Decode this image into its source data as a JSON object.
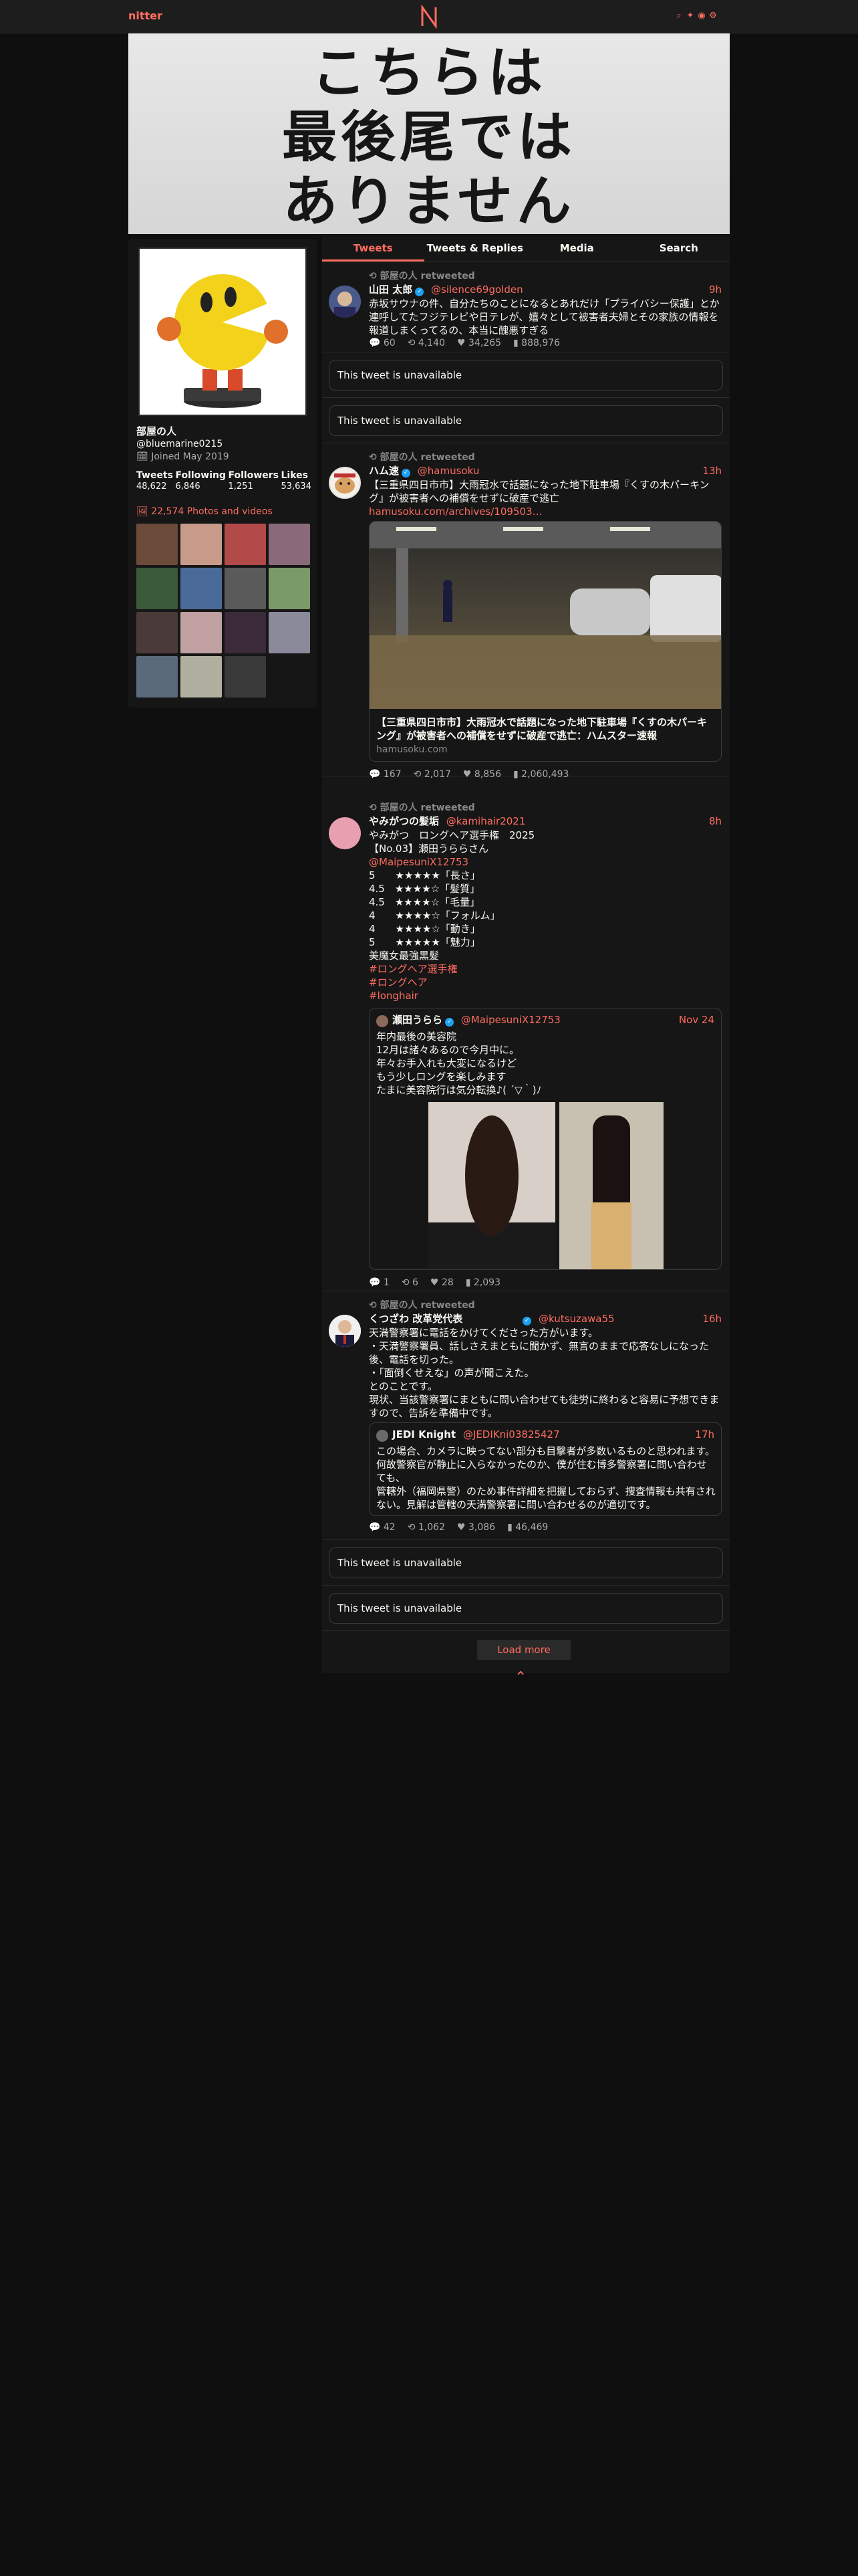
{
  "nav": {
    "logo": "nitter",
    "icons": [
      "search-icon",
      "twitter-icon",
      "rss-icon",
      "settings-icon"
    ]
  },
  "banner": {
    "lines": [
      "こちらは",
      "最後尾では",
      "ありません"
    ]
  },
  "profile": {
    "name": "部屋の人",
    "handle": "@bluemarine0215",
    "joined": "Joined May 2019",
    "stats": [
      {
        "label": "Tweets",
        "value": "48,622"
      },
      {
        "label": "Following",
        "value": "6,846"
      },
      {
        "label": "Followers",
        "value": "1,251"
      },
      {
        "label": "Likes",
        "value": "53,634"
      }
    ],
    "photos_link": "22,574 Photos and videos",
    "thumb_colors": [
      "#6b4a3a",
      "#c79a8a",
      "#b34a4a",
      "#8a6a7a",
      "#3a5a3a",
      "#4a6a9a",
      "#5a5a5a",
      "#7a9a6a",
      "#4a3a3a",
      "#c0a0a0",
      "#3a2a3a",
      "#8a8a9a",
      "#5a6a7a",
      "#b0b0a0",
      "#3a3a3a"
    ]
  },
  "tabs": [
    "Tweets",
    "Tweets & Replies",
    "Media",
    "Search"
  ],
  "tweets": [
    {
      "retweet": "部屋の人 retweeted",
      "name": "山田 太郎",
      "handle": "@silence69golden",
      "time": "9h",
      "text": "赤坂サウナの件、自分たちのことになるとあれだけ「プライバシー保護」とか連呼してたフジテレビや日テレが、嬉々として被害者夫婦とその家族の情報を報道しまくってるの、本当に醜悪すぎる",
      "stats": {
        "replies": "60",
        "retweets": "4,140",
        "likes": "34,265",
        "views": "888,976"
      }
    },
    {
      "retweet": "部屋の人 retweeted",
      "name": "ハム速",
      "handle": "@hamusoku",
      "time": "13h",
      "text": "【三重県四日市市】大雨冠水で話題になった地下駐車場『くすの木パーキング』が被害者への補償をせずに破産で逃亡",
      "link": "hamusoku.com/archives/109503…",
      "card_title": "【三重県四日市市】大雨冠水で話題になった地下駐車場『くすの木パーキング』が被害者への補償をせずに破産で逃亡：ハムスター速報",
      "card_domain": "hamusoku.com",
      "stats": {
        "replies": "167",
        "retweets": "2,017",
        "likes": "8,856",
        "views": "2,060,493"
      }
    },
    {
      "retweet": "部屋の人 retweeted",
      "name": "やみがつの髪垢",
      "handle": "@kamihair2021",
      "time": "8h",
      "text": "やみがつ　ロングヘア選手権　2025\n【No.03】瀬田うららさん",
      "mention": "@MaipesuniX12753",
      "ratings": "5　　★★★★★「長さ」\n4.5　★★★★☆「髪質」\n4.5　★★★★☆「毛量」\n4　　★★★★☆「フォルム」\n4　　★★★★☆「動き」\n5　　★★★★★「魅力」\n美魔女最強黒髪",
      "hashtags": [
        "#ロングヘア選手権",
        "#ロングヘア",
        "#longhair"
      ],
      "quote": {
        "name": "瀬田うらら",
        "handle": "@MaipesuniX12753",
        "time": "Nov 24",
        "text": "年内最後の美容院\n12月は諸々あるので今月中に。\n年々お手入れも大変になるけど\nもう少しロングを楽しみます\nたまに美容院行は気分転換♪( ´▽｀)ﾉ"
      },
      "stats": {
        "replies": "1",
        "retweets": "6",
        "likes": "28",
        "views": "2,093"
      }
    },
    {
      "retweet": "部屋の人 retweeted",
      "name": "くつざわ 改革党代表",
      "handle": "@kutsuzawa55",
      "time": "16h",
      "text": "天満警察署に電話をかけてくださった方がいます。\n・天満警察署員、話しさえまともに聞かず、無言のままで応答なしになった後、電話を切った。\n・「面倒くせえな」の声が聞こえた。\nとのことです。\n現状、当該警察署にまともに問い合わせても徒労に終わると容易に予想できますので、告訴を準備中です。",
      "quote": {
        "name": "JEDI Knight",
        "handle": "@JEDIKni03825427",
        "time": "17h",
        "text": "この場合、カメラに映ってない部分も目撃者が多数いるものと思われます。\n何故警察官が静止に入らなかったのか、僕が住む博多警察署に問い合わせても、\n管轄外（福岡県警）のため事件詳細を把握しておらず、捜査情報も共有されない。見解は管轄の天満警察署に問い合わせるのが適切です。"
      },
      "stats": {
        "replies": "42",
        "retweets": "1,062",
        "likes": "3,086",
        "views": "46,469"
      }
    }
  ],
  "unavailable_text": "This tweet is unavailable",
  "load_more": "Load more"
}
